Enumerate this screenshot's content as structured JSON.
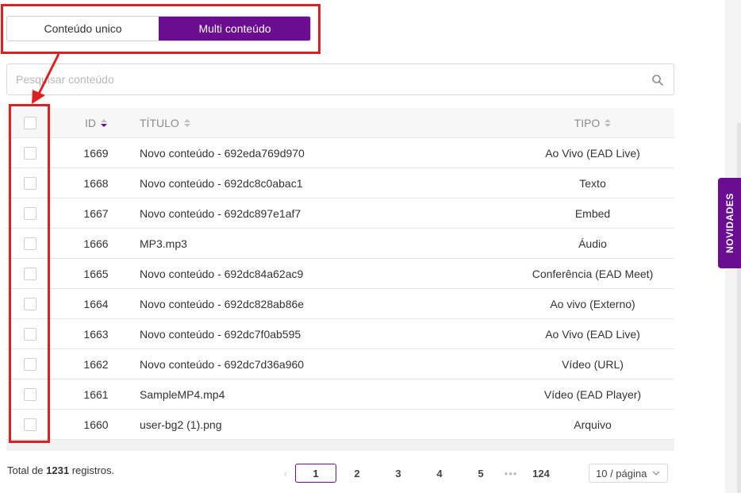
{
  "toggle": {
    "single_label": "Conteúdo unico",
    "multi_label": "Multi conteúdo",
    "selected": "multi"
  },
  "search": {
    "placeholder": "Pesquisar conteúdo",
    "icon": "search-icon"
  },
  "table": {
    "columns": {
      "id": "ID",
      "title": "TÍTULO",
      "type": "TIPO"
    },
    "sort": {
      "column": "id",
      "direction": "descending"
    },
    "rows": [
      {
        "id": "1669",
        "title": "Novo conteúdo - 692eda769d970",
        "type": "Ao Vivo (EAD Live)"
      },
      {
        "id": "1668",
        "title": "Novo conteúdo - 692dc8c0abac1",
        "type": "Texto"
      },
      {
        "id": "1667",
        "title": "Novo conteúdo - 692dc897e1af7",
        "type": "Embed"
      },
      {
        "id": "1666",
        "title": "MP3.mp3",
        "type": "Áudio"
      },
      {
        "id": "1665",
        "title": "Novo conteúdo - 692dc84a62ac9",
        "type": "Conferência (EAD Meet)"
      },
      {
        "id": "1664",
        "title": "Novo conteúdo - 692dc828ab86e",
        "type": "Ao vivo (Externo)"
      },
      {
        "id": "1663",
        "title": "Novo conteúdo - 692dc7f0ab595",
        "type": "Ao Vivo (EAD Live)"
      },
      {
        "id": "1662",
        "title": "Novo conteúdo - 692dc7d36a960",
        "type": "Vídeo (URL)"
      },
      {
        "id": "1661",
        "title": "SampleMP4.mp4",
        "type": "Vídeo (EAD Player)"
      },
      {
        "id": "1660",
        "title": "user-bg2 (1).png",
        "type": "Arquivo"
      }
    ]
  },
  "footer": {
    "total_prefix": "Total de ",
    "total_count": "1231",
    "total_suffix": " registros.",
    "pages": [
      "1",
      "2",
      "3",
      "4",
      "5"
    ],
    "current_page": "1",
    "ellipsis": "•••",
    "last_page": "124",
    "page_size": "10 / página"
  },
  "sidebar_tab": {
    "label": "NOVIDADES"
  },
  "colors": {
    "accent": "#6a0d91",
    "annotation": "#e02020"
  }
}
